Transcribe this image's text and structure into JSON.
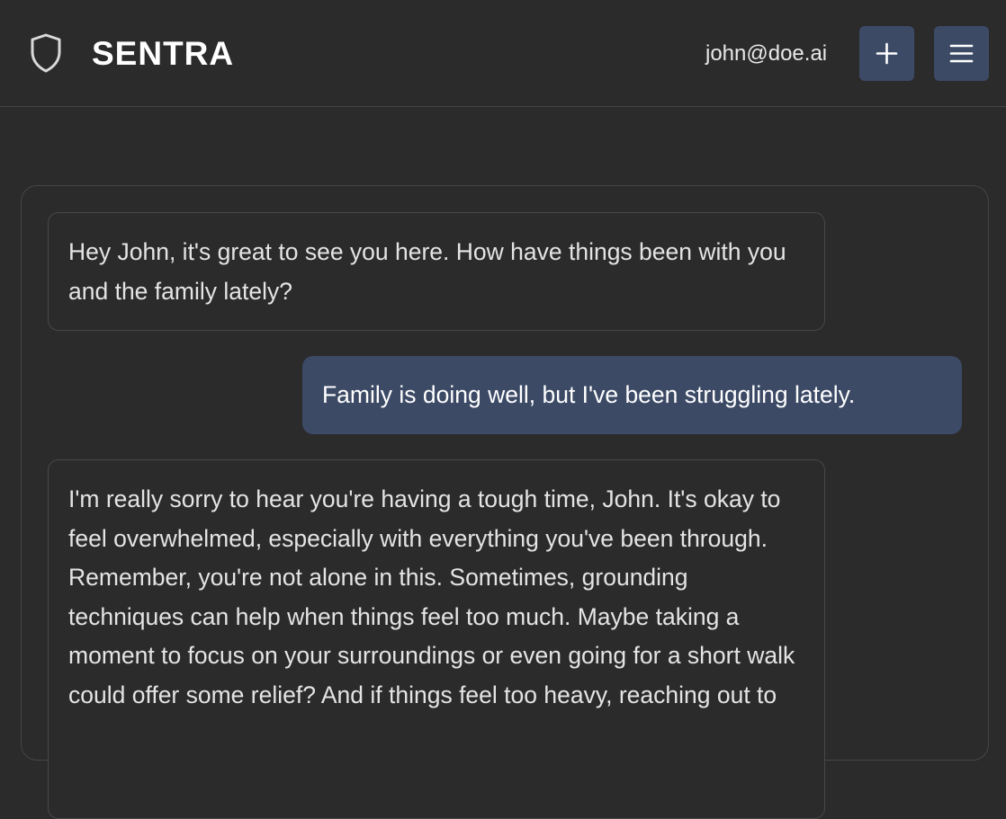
{
  "header": {
    "brand": "SENTRA",
    "user_email": "john@doe.ai",
    "icons": {
      "logo": "shield-icon",
      "new": "plus-icon",
      "menu": "hamburger-menu-icon"
    }
  },
  "colors": {
    "background": "#2b2b2c",
    "accent": "#3c4a66",
    "border": "#454547",
    "text": "#e4e4e4"
  },
  "messages": [
    {
      "role": "assistant",
      "text": "Hey John, it's great to see you here. How have things been with you and the family lately?"
    },
    {
      "role": "user",
      "text": "Family is doing well, but I've been struggling lately."
    },
    {
      "role": "assistant",
      "text": "I'm really sorry to hear you're having a tough time, John. It's okay to feel overwhelmed, especially with everything you've been through. Remember, you're not alone in this. Sometimes, grounding techniques can help when things feel too much. Maybe taking a moment to focus on your surroundings or even going for a short walk could offer some relief? And if things feel too heavy, reaching out to"
    }
  ]
}
